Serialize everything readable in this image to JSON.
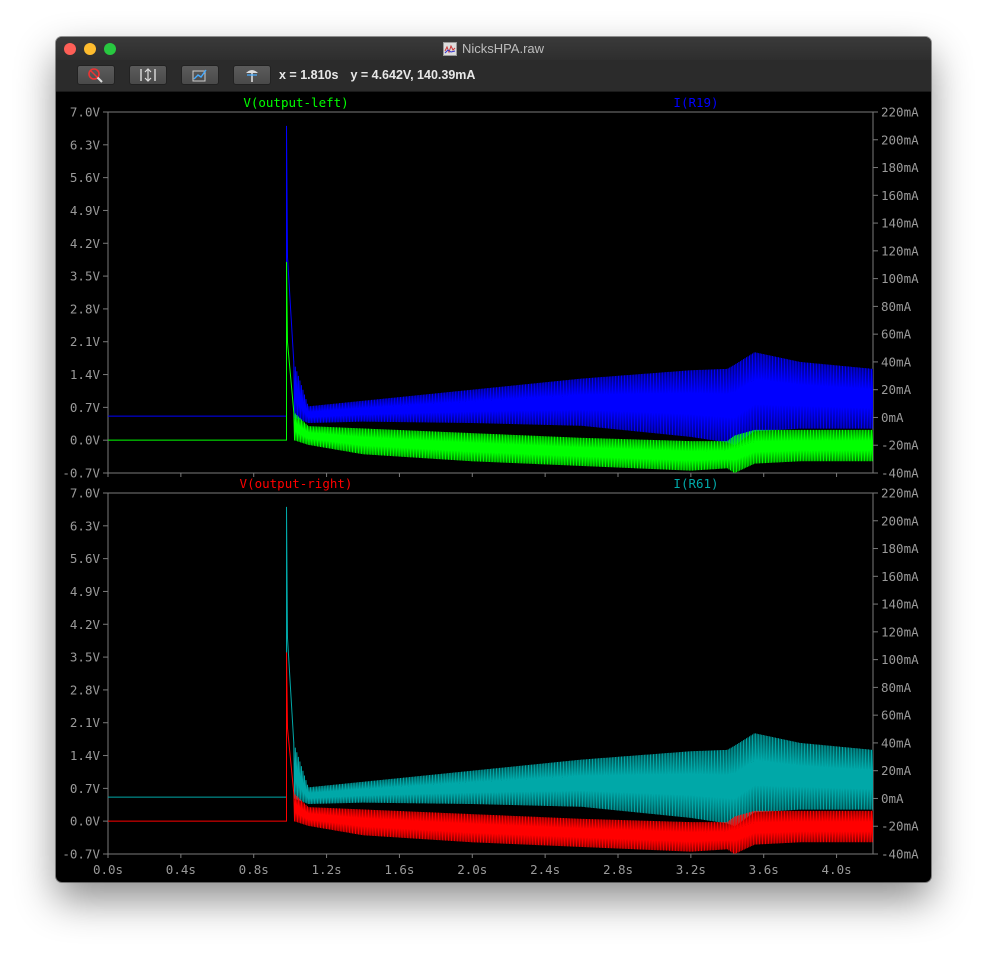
{
  "window": {
    "title": "NicksHPA.raw"
  },
  "toolbar": {
    "buttons": [
      {
        "name": "zoom-out",
        "icon": "magnifier-cross-icon"
      },
      {
        "name": "autorange-y",
        "icon": "autorange-y-icon"
      },
      {
        "name": "zoom-to-fit",
        "icon": "zoom-fit-icon"
      },
      {
        "name": "cursor-tool",
        "icon": "cursor-probe-icon"
      }
    ],
    "cursor_x": "x = 1.810s",
    "cursor_y": "y = 4.642V, 140.39mA"
  },
  "colors": {
    "background": "#000000",
    "grid": "#7a7a7a",
    "v_left": "#00ff00",
    "i_r19": "#0000ff",
    "v_right": "#ff0000",
    "i_r61": "#00a8a8",
    "axis_text": "#9a9a9a"
  },
  "chart_data": [
    {
      "type": "line",
      "panel": "top",
      "x_range": [
        0,
        4.2
      ],
      "x_ticks": [
        "0.0s",
        "0.4s",
        "0.8s",
        "1.2s",
        "1.6s",
        "2.0s",
        "2.4s",
        "2.8s",
        "3.2s",
        "3.6s",
        "4.0s"
      ],
      "y_left_range": [
        -0.7,
        7.0
      ],
      "y_left_ticks": [
        "7.0V",
        "6.3V",
        "5.6V",
        "4.9V",
        "4.2V",
        "3.5V",
        "2.8V",
        "2.1V",
        "1.4V",
        "0.7V",
        "0.0V",
        "-0.7V"
      ],
      "y_right_range": [
        -40,
        220
      ],
      "y_right_ticks": [
        "220mA",
        "200mA",
        "180mA",
        "160mA",
        "140mA",
        "120mA",
        "100mA",
        "80mA",
        "60mA",
        "40mA",
        "20mA",
        "0mA",
        "-20mA",
        "-40mA"
      ],
      "series": [
        {
          "name": "V(output-left)",
          "axis": "left",
          "color": "#00ff00",
          "step_time": 0.98,
          "pre_step": 0.0,
          "spike": 3.8,
          "envelope": {
            "x": [
              1.02,
              1.1,
              1.4,
              2.0,
              2.6,
              3.2,
              3.4,
              3.44,
              3.55,
              3.8,
              4.2
            ],
            "upper": [
              0.6,
              0.3,
              0.25,
              0.15,
              0.05,
              -0.02,
              -0.02,
              0.1,
              0.22,
              0.22,
              0.22
            ],
            "lower": [
              0.0,
              -0.1,
              -0.3,
              -0.45,
              -0.55,
              -0.65,
              -0.6,
              -0.7,
              -0.5,
              -0.45,
              -0.45
            ]
          }
        },
        {
          "name": "I(R19)",
          "axis": "right",
          "color": "#0000ff",
          "step_time": 0.98,
          "pre_step": 1.0,
          "spike": 210,
          "envelope": {
            "x": [
              1.02,
              1.1,
              1.4,
              2.0,
              2.6,
              3.2,
              3.4,
              3.44,
              3.55,
              3.8,
              4.2
            ],
            "upper": [
              40,
              8,
              12,
              20,
              28,
              34,
              35,
              38,
              47,
              40,
              35
            ],
            "lower": [
              0,
              -4,
              -3,
              -4,
              -6,
              -14,
              -18,
              -20,
              -10,
              -8,
              -8
            ]
          }
        }
      ]
    },
    {
      "type": "line",
      "panel": "bottom",
      "x_range": [
        0,
        4.2
      ],
      "x_ticks": [
        "0.0s",
        "0.4s",
        "0.8s",
        "1.2s",
        "1.6s",
        "2.0s",
        "2.4s",
        "2.8s",
        "3.2s",
        "3.6s",
        "4.0s"
      ],
      "y_left_range": [
        -0.7,
        7.0
      ],
      "y_left_ticks": [
        "7.0V",
        "6.3V",
        "5.6V",
        "4.9V",
        "4.2V",
        "3.5V",
        "2.8V",
        "2.1V",
        "1.4V",
        "0.7V",
        "0.0V",
        "-0.7V"
      ],
      "y_right_range": [
        -40,
        220
      ],
      "y_right_ticks": [
        "220mA",
        "200mA",
        "180mA",
        "160mA",
        "140mA",
        "120mA",
        "100mA",
        "80mA",
        "60mA",
        "40mA",
        "20mA",
        "0mA",
        "-20mA",
        "-40mA"
      ],
      "series": [
        {
          "name": "V(output-right)",
          "axis": "left",
          "color": "#ff0000",
          "step_time": 0.98,
          "pre_step": 0.0,
          "spike": 3.6,
          "envelope": {
            "x": [
              1.02,
              1.1,
              1.4,
              2.0,
              2.6,
              3.2,
              3.4,
              3.44,
              3.55,
              3.8,
              4.2
            ],
            "upper": [
              0.6,
              0.3,
              0.25,
              0.15,
              0.05,
              -0.02,
              -0.02,
              0.1,
              0.22,
              0.22,
              0.22
            ],
            "lower": [
              0.0,
              -0.1,
              -0.3,
              -0.45,
              -0.55,
              -0.65,
              -0.6,
              -0.7,
              -0.5,
              -0.45,
              -0.45
            ]
          }
        },
        {
          "name": "I(R61)",
          "axis": "right",
          "color": "#00a8a8",
          "step_time": 0.98,
          "pre_step": 1.0,
          "spike": 210,
          "envelope": {
            "x": [
              1.02,
              1.1,
              1.4,
              2.0,
              2.6,
              3.2,
              3.4,
              3.44,
              3.55,
              3.8,
              4.2
            ],
            "upper": [
              40,
              8,
              12,
              20,
              28,
              34,
              35,
              38,
              47,
              40,
              35
            ],
            "lower": [
              0,
              -4,
              -3,
              -4,
              -6,
              -14,
              -18,
              -20,
              -10,
              -8,
              -8
            ]
          }
        }
      ]
    }
  ]
}
